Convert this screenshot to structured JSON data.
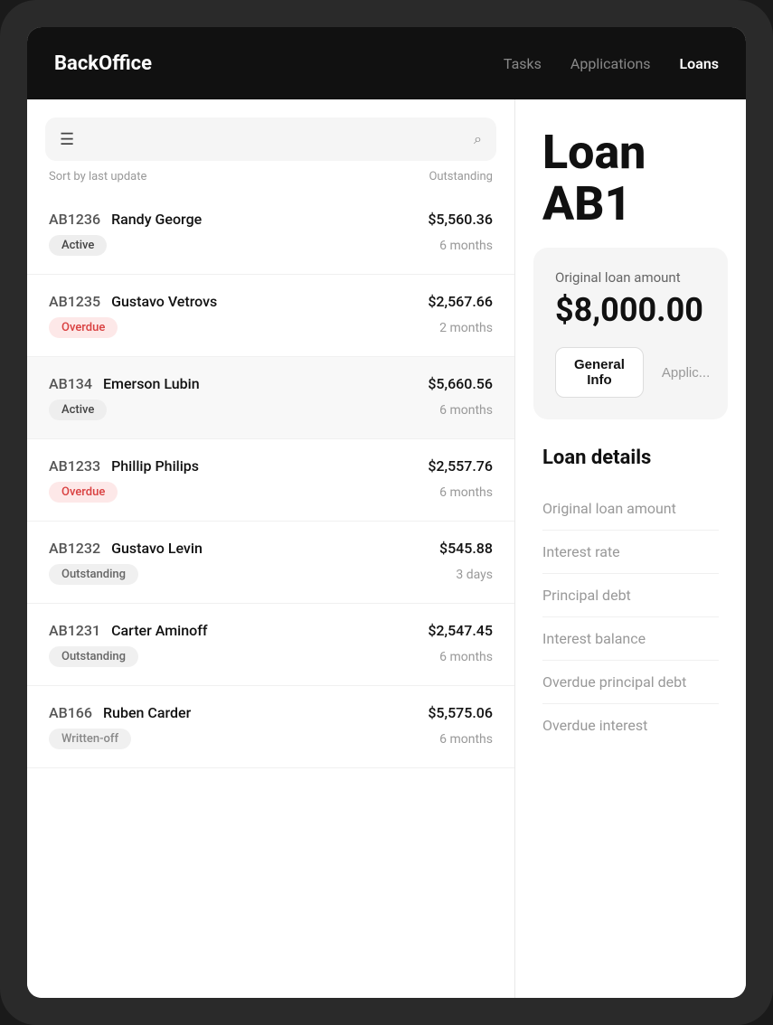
{
  "app": {
    "logo": "BackOffice"
  },
  "nav": {
    "items": [
      {
        "label": "Tasks",
        "active": false
      },
      {
        "label": "Applications",
        "active": false
      },
      {
        "label": "Loans",
        "active": true
      }
    ]
  },
  "search": {
    "placeholder": "",
    "sort_label": "Sort by last update",
    "sort_value": "Outstanding"
  },
  "loans": [
    {
      "id": "AB1236",
      "name": "Randy George",
      "amount": "$5,560.36",
      "status": "Active",
      "status_type": "active",
      "duration": "6 months",
      "selected": false
    },
    {
      "id": "AB1235",
      "name": "Gustavo Vetrovs",
      "amount": "$2,567.66",
      "status": "Overdue",
      "status_type": "overdue",
      "duration": "2 months",
      "selected": false
    },
    {
      "id": "AB134",
      "name": "Emerson Lubin",
      "amount": "$5,660.56",
      "status": "Active",
      "status_type": "active",
      "duration": "6 months",
      "selected": true
    },
    {
      "id": "AB1233",
      "name": "Phillip Philips",
      "amount": "$2,557.76",
      "status": "Overdue",
      "status_type": "overdue",
      "duration": "6 months",
      "selected": false
    },
    {
      "id": "AB1232",
      "name": "Gustavo Levin",
      "amount": "$545.88",
      "status": "Outstanding",
      "status_type": "outstanding",
      "duration": "3 days",
      "selected": false
    },
    {
      "id": "AB1231",
      "name": "Carter Aminoff",
      "amount": "$2,547.45",
      "status": "Outstanding",
      "status_type": "outstanding",
      "duration": "6 months",
      "selected": false
    },
    {
      "id": "AB166",
      "name": "Ruben Carder",
      "amount": "$5,575.06",
      "status": "Written-off",
      "status_type": "written-off",
      "duration": "6 months",
      "selected": false
    }
  ],
  "detail": {
    "title": "Loan AB1",
    "original_loan_label": "Original loan amount",
    "original_loan_amount": "$8,000.00",
    "tabs": [
      {
        "label": "General Info",
        "active": true
      },
      {
        "label": "Applic...",
        "active": false
      }
    ],
    "section_title": "Loan details",
    "fields": [
      {
        "label": "Original loan amount"
      },
      {
        "label": "Interest rate"
      },
      {
        "label": "Principal debt"
      },
      {
        "label": "Interest balance"
      },
      {
        "label": "Overdue principal debt"
      },
      {
        "label": "Overdue interest"
      }
    ]
  }
}
